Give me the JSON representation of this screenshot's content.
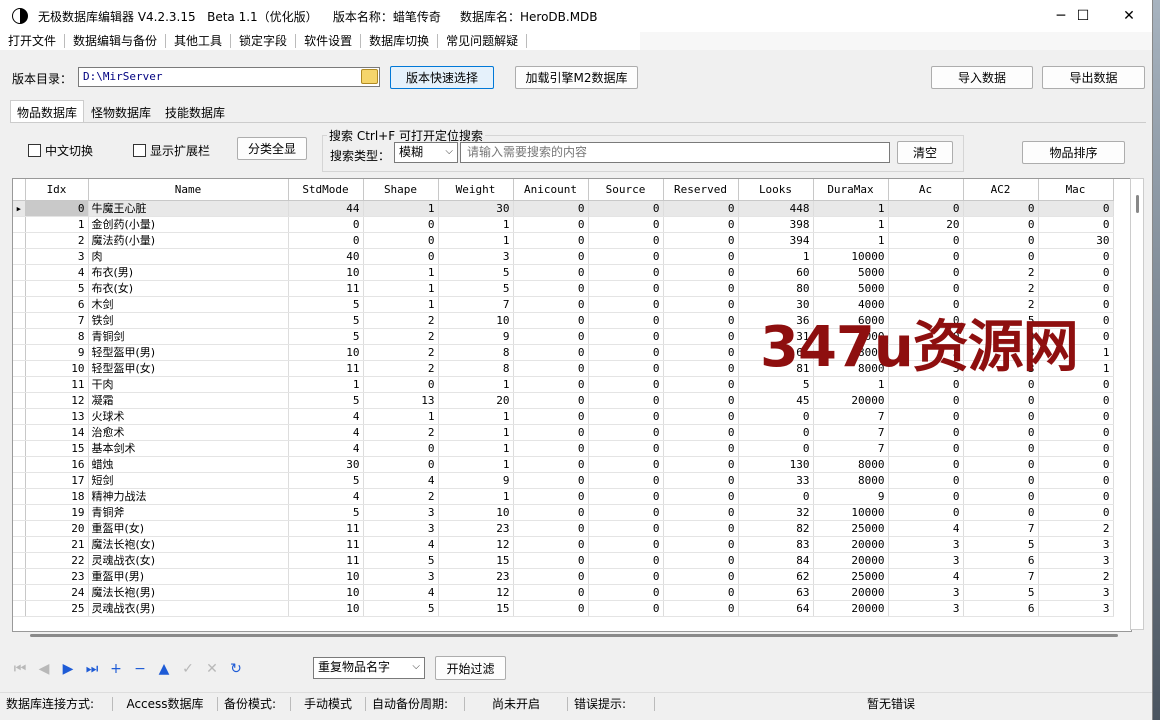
{
  "window": {
    "title": "无极数据库编辑器 V4.2.3.15   Beta 1.1（优化版）    版本名称：蜡笔传奇     数据库名：HeroDB.MDB",
    "controls": {
      "minimize": "─",
      "maximize": "☐",
      "close": "✕"
    }
  },
  "menu": [
    "打开文件",
    "数据编辑与备份",
    "其他工具",
    "锁定字段",
    "软件设置",
    "数据库切换",
    "常见问题解疑"
  ],
  "toolbar": {
    "dir_label": "版本目录：",
    "dir_value": "D:\\MirServer",
    "quick_select": "版本快速选择",
    "load_engine": "加载引擎M2数据库",
    "import": "导入数据",
    "export": "导出数据"
  },
  "tabs": [
    "物品数据库",
    "怪物数据库",
    "技能数据库"
  ],
  "options": {
    "chinese_switch": "中文切换",
    "show_ext": "显示扩展栏",
    "category_all": "分类全显",
    "search_group": "搜索   Ctrl+F 可打开定位搜索",
    "search_type_label": "搜索类型：",
    "search_type_value": "模糊",
    "search_placeholder": "请输入需要搜索的内容",
    "clear": "清空",
    "sort": "物品排序"
  },
  "grid": {
    "columns": [
      "Idx",
      "Name",
      "StdMode",
      "Shape",
      "Weight",
      "Anicount",
      "Source",
      "Reserved",
      "Looks",
      "DuraMax",
      "Ac",
      "AC2",
      "Mac"
    ],
    "rows": [
      [
        0,
        "牛魔王心脏",
        44,
        1,
        30,
        0,
        0,
        0,
        448,
        1,
        0,
        0,
        0
      ],
      [
        1,
        "金创药(小量)",
        0,
        0,
        1,
        0,
        0,
        0,
        398,
        1,
        20,
        0,
        0
      ],
      [
        2,
        "魔法药(小量)",
        0,
        0,
        1,
        0,
        0,
        0,
        394,
        1,
        0,
        0,
        30
      ],
      [
        3,
        "肉",
        40,
        0,
        3,
        0,
        0,
        0,
        1,
        10000,
        0,
        0,
        0
      ],
      [
        4,
        "布衣(男)",
        10,
        1,
        5,
        0,
        0,
        0,
        60,
        5000,
        0,
        2,
        0
      ],
      [
        5,
        "布衣(女)",
        11,
        1,
        5,
        0,
        0,
        0,
        80,
        5000,
        0,
        2,
        0
      ],
      [
        6,
        "木剑",
        5,
        1,
        7,
        0,
        0,
        0,
        30,
        4000,
        0,
        2,
        0
      ],
      [
        7,
        "铁剑",
        5,
        2,
        10,
        0,
        0,
        0,
        36,
        6000,
        0,
        5,
        0
      ],
      [
        8,
        "青铜剑",
        5,
        2,
        9,
        0,
        0,
        0,
        31,
        6000,
        0,
        3,
        0
      ],
      [
        9,
        "轻型盔甲(男)",
        10,
        2,
        8,
        0,
        0,
        0,
        61,
        8000,
        3,
        3,
        1
      ],
      [
        10,
        "轻型盔甲(女)",
        11,
        2,
        8,
        0,
        0,
        0,
        81,
        8000,
        3,
        3,
        1
      ],
      [
        11,
        "干肉",
        1,
        0,
        1,
        0,
        0,
        0,
        5,
        1,
        0,
        0,
        0
      ],
      [
        12,
        "凝霜",
        5,
        13,
        20,
        0,
        0,
        0,
        45,
        20000,
        0,
        0,
        0
      ],
      [
        13,
        "火球术",
        4,
        1,
        1,
        0,
        0,
        0,
        0,
        7,
        0,
        0,
        0
      ],
      [
        14,
        "治愈术",
        4,
        2,
        1,
        0,
        0,
        0,
        0,
        7,
        0,
        0,
        0
      ],
      [
        15,
        "基本剑术",
        4,
        0,
        1,
        0,
        0,
        0,
        0,
        7,
        0,
        0,
        0
      ],
      [
        16,
        "蜡烛",
        30,
        0,
        1,
        0,
        0,
        0,
        130,
        8000,
        0,
        0,
        0
      ],
      [
        17,
        "短剑",
        5,
        4,
        9,
        0,
        0,
        0,
        33,
        8000,
        0,
        0,
        0
      ],
      [
        18,
        "精神力战法",
        4,
        2,
        1,
        0,
        0,
        0,
        0,
        9,
        0,
        0,
        0
      ],
      [
        19,
        "青铜斧",
        5,
        3,
        10,
        0,
        0,
        0,
        32,
        10000,
        0,
        0,
        0
      ],
      [
        20,
        "重盔甲(女)",
        11,
        3,
        23,
        0,
        0,
        0,
        82,
        25000,
        4,
        7,
        2
      ],
      [
        21,
        "魔法长袍(女)",
        11,
        4,
        12,
        0,
        0,
        0,
        83,
        20000,
        3,
        5,
        3
      ],
      [
        22,
        "灵魂战衣(女)",
        11,
        5,
        15,
        0,
        0,
        0,
        84,
        20000,
        3,
        6,
        3
      ],
      [
        23,
        "重盔甲(男)",
        10,
        3,
        23,
        0,
        0,
        0,
        62,
        25000,
        4,
        7,
        2
      ],
      [
        24,
        "魔法长袍(男)",
        10,
        4,
        12,
        0,
        0,
        0,
        63,
        20000,
        3,
        5,
        3
      ],
      [
        25,
        "灵魂战衣(男)",
        10,
        5,
        15,
        0,
        0,
        0,
        64,
        20000,
        3,
        6,
        3
      ]
    ]
  },
  "navigator": {
    "buttons": [
      {
        "icon": "first-record-icon",
        "glyph": "⏮",
        "enabled": false
      },
      {
        "icon": "prior-record-icon",
        "glyph": "◀",
        "enabled": false
      },
      {
        "icon": "next-record-icon",
        "glyph": "▶",
        "enabled": true
      },
      {
        "icon": "last-record-icon",
        "glyph": "⏭",
        "enabled": true
      },
      {
        "icon": "insert-icon",
        "glyph": "+",
        "enabled": true
      },
      {
        "icon": "delete-icon",
        "glyph": "−",
        "enabled": true
      },
      {
        "icon": "edit-icon",
        "glyph": "▲",
        "enabled": true
      },
      {
        "icon": "post-icon",
        "glyph": "✓",
        "enabled": false
      },
      {
        "icon": "cancel-icon",
        "glyph": "✕",
        "enabled": false
      },
      {
        "icon": "refresh-icon",
        "glyph": "↻",
        "enabled": true
      }
    ],
    "filter_value": "重复物品名字",
    "filter_button": "开始过滤"
  },
  "status": {
    "conn_label": "数据库连接方式:",
    "conn_value": "Access数据库",
    "backup_label": "备份模式:",
    "backup_value": "手动模式",
    "auto_label": "自动备份周期:",
    "auto_value": "尚未开启",
    "err_label": "错误提示:",
    "err_value": "暂无错误"
  },
  "watermark": "347u资源网",
  "colors": {
    "accent": "#0078d7",
    "watermark": "#8e0f0f",
    "nav_blue": "#1e5bd6"
  }
}
